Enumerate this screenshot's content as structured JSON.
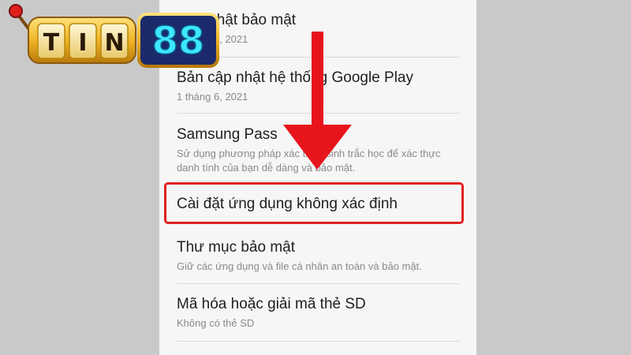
{
  "settings": {
    "items": [
      {
        "title": "Cập nhật bảo mật",
        "subtitle": "1 tháng 4, 2021"
      },
      {
        "title": "Bản cập nhật hệ thống Google Play",
        "subtitle": "1 tháng 6, 2021"
      },
      {
        "title": "Samsung Pass",
        "subtitle": "Sử dụng phương pháp xác thực sinh trắc học để xác thực danh tính của bạn dễ dàng và bảo mật."
      },
      {
        "title": "Cài đặt ứng dụng không xác định",
        "subtitle": ""
      },
      {
        "title": "Thư mục bảo mật",
        "subtitle": "Giữ các ứng dụng và file cá nhân an toàn và bảo mật."
      },
      {
        "title": "Mã hóa hoặc giải mã thẻ SD",
        "subtitle": "Không có thẻ SD"
      }
    ]
  },
  "logo": {
    "letters": [
      "T",
      "I",
      "N"
    ],
    "number": "88"
  },
  "colors": {
    "highlight": "#e02020",
    "arrow": "#e8141c",
    "logo_gold": "#f0b526",
    "logo_cyan": "#3ee6ff"
  },
  "annotations": {
    "arrow_icon": "down-arrow-icon",
    "highlight_target": "Cài đặt ứng dụng không xác định"
  }
}
